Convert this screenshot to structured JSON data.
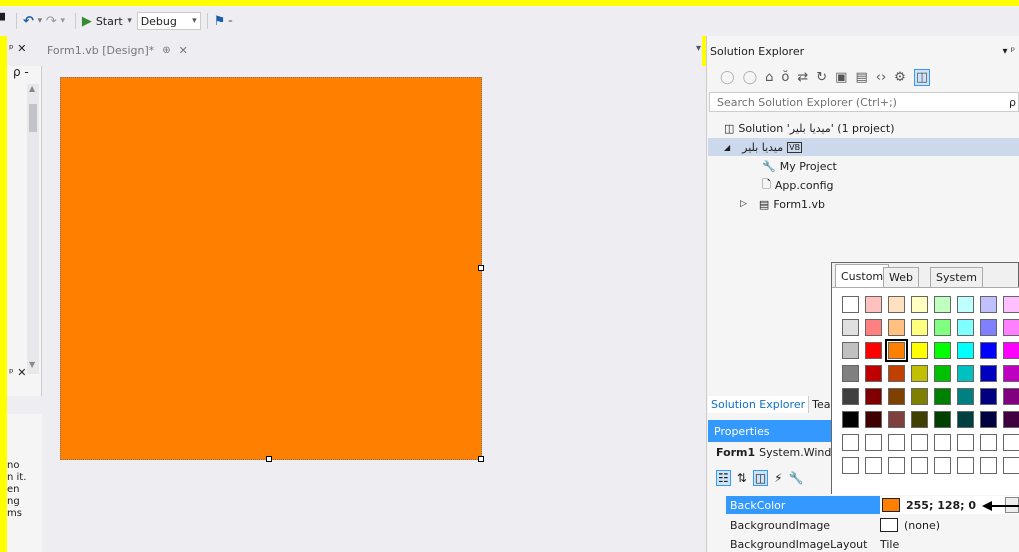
{
  "toolbar": {
    "start_label": "Start",
    "config_value": "Debug",
    "config_arrow": "▾",
    "start_dropdown": "▾",
    "undo_dropdown": "▾",
    "redo_dropdown": "▾",
    "overflow": "₌"
  },
  "left_pane": {
    "pin_top": "ᵖ ✕",
    "search_glyph": "ρ -",
    "pin_bottom": "ᵖ ✕",
    "clipped_text": [
      "no",
      "n it.",
      "en",
      "ng",
      "ms"
    ]
  },
  "document_tab": {
    "label": "Form1.vb [Design]*",
    "pin": "⊕",
    "close": "✕"
  },
  "solution_explorer": {
    "dropdown_glyph": "▾",
    "title": "Solution Explorer",
    "title_controls": "▾ ᵖ",
    "search_placeholder": "Search Solution Explorer (Ctrl+;)",
    "search_glyph": "ρ",
    "tree": [
      {
        "label": "Solution 'ميديا بلير' (1 project)",
        "icon": "solution-icon"
      },
      {
        "label": "ميديا بلير",
        "icon": "vb-project-icon",
        "expander": "◢"
      },
      {
        "label": "My Project",
        "icon": "wrench-icon"
      },
      {
        "label": "App.config",
        "icon": "config-file-icon"
      },
      {
        "label": "Form1.vb",
        "icon": "form-file-icon",
        "expander": "▷"
      }
    ]
  },
  "bottom_tabs": [
    "Solution Explorer",
    "Tear"
  ],
  "properties": {
    "title": "Properties",
    "object_name": "Form1",
    "object_type": "System.Windov",
    "rows": [
      {
        "name": "BackColor",
        "value": "255; 128; 0",
        "swatch": "#ff8000"
      },
      {
        "name": "BackgroundImage",
        "value": "(none)",
        "swatch": "#ffffff"
      },
      {
        "name": "BackgroundImageLayout",
        "value": "Tile"
      }
    ]
  },
  "color_picker": {
    "tabs": [
      "Custom",
      "Web",
      "System"
    ],
    "active_tab": "Custom",
    "selected_color": "#ff8000",
    "rows": [
      [
        "#ffffff",
        "#ffc0c0",
        "#ffe0c0",
        "#ffffc0",
        "#c0ffc0",
        "#c0ffff",
        "#c0c0ff",
        "#ffc0ff"
      ],
      [
        "#e0e0e0",
        "#ff8080",
        "#ffc080",
        "#ffff80",
        "#80ff80",
        "#80ffff",
        "#8080ff",
        "#ff80ff"
      ],
      [
        "#c0c0c0",
        "#ff0000",
        "#ff8000",
        "#ffff00",
        "#00ff00",
        "#00ffff",
        "#0000ff",
        "#ff00ff"
      ],
      [
        "#808080",
        "#c00000",
        "#c04000",
        "#c0c000",
        "#00c000",
        "#00c0c0",
        "#0000c0",
        "#c000c0"
      ],
      [
        "#404040",
        "#800000",
        "#804000",
        "#808000",
        "#008000",
        "#008080",
        "#000080",
        "#800080"
      ],
      [
        "#000000",
        "#400000",
        "#804040",
        "#404000",
        "#004000",
        "#004040",
        "#000040",
        "#400040"
      ],
      [
        "#ffffff",
        "#ffffff",
        "#ffffff",
        "#ffffff",
        "#ffffff",
        "#ffffff",
        "#ffffff",
        "#ffffff"
      ],
      [
        "#ffffff",
        "#ffffff",
        "#ffffff",
        "#ffffff",
        "#ffffff",
        "#ffffff",
        "#ffffff",
        "#ffffff"
      ]
    ]
  },
  "form": {
    "back_color": "#ff8000"
  }
}
